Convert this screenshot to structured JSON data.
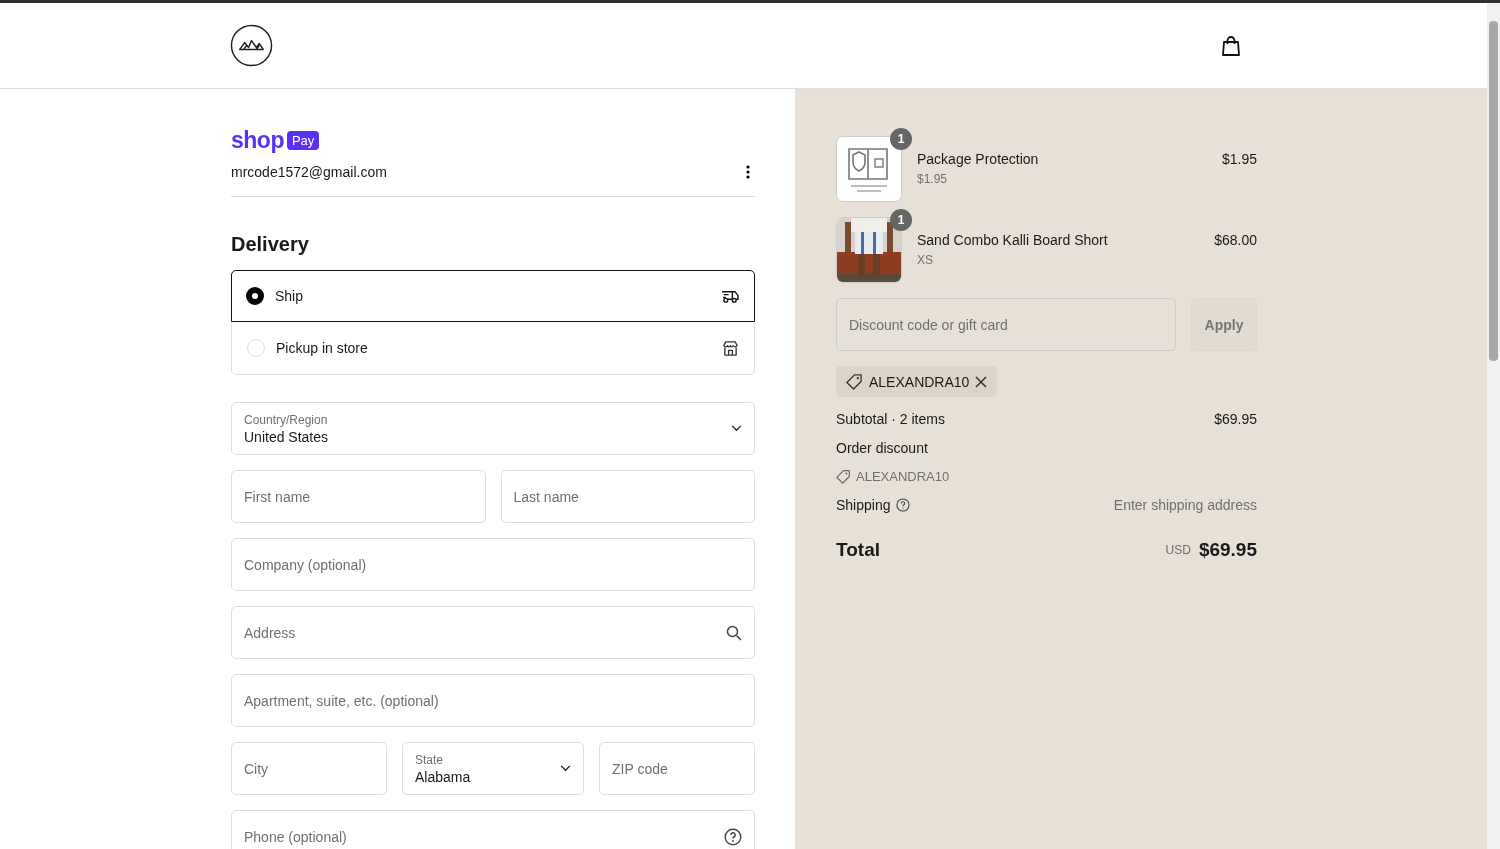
{
  "express": {
    "brand": "shop",
    "badge": "Pay",
    "email": "mrcode1572@gmail.com"
  },
  "delivery": {
    "title": "Delivery",
    "options": [
      {
        "label": "Ship",
        "selected": true
      },
      {
        "label": "Pickup in store",
        "selected": false
      }
    ]
  },
  "address_form": [
    [
      {
        "kind": "select",
        "label": "Country/Region",
        "value": "United States"
      }
    ],
    [
      {
        "kind": "text",
        "placeholder": "First name"
      },
      {
        "kind": "text",
        "placeholder": "Last name"
      }
    ],
    [
      {
        "kind": "text",
        "placeholder": "Company (optional)"
      }
    ],
    [
      {
        "kind": "address",
        "placeholder": "Address"
      }
    ],
    [
      {
        "kind": "text",
        "placeholder": "Apartment, suite, etc. (optional)"
      }
    ],
    [
      {
        "kind": "text",
        "placeholder": "City"
      },
      {
        "kind": "select",
        "label": "State",
        "value": "Alabama"
      },
      {
        "kind": "text",
        "placeholder": "ZIP code"
      }
    ],
    [
      {
        "kind": "phone",
        "placeholder": "Phone (optional)"
      }
    ]
  ],
  "cart": {
    "items": [
      {
        "name": "Package Protection",
        "detail": "$1.95",
        "price": "$1.95",
        "quantity": "1",
        "kind": "illustration"
      },
      {
        "name": "Sand Combo Kalli Board Short",
        "detail": "XS",
        "price": "$68.00",
        "quantity": "1",
        "kind": "picture"
      }
    ],
    "discount": {
      "placeholder": "Discount code or gift card",
      "button": "Apply",
      "applied": "ALEXANDRA10"
    },
    "subtotal": {
      "label": "Subtotal · 2 items",
      "value": "$69.95"
    },
    "order_discount": {
      "label": "Order discount",
      "code": "ALEXANDRA10"
    },
    "shipping": {
      "label": "Shipping",
      "value": "Enter shipping address"
    },
    "total": {
      "label": "Total",
      "currency": "USD",
      "value": "$69.95"
    }
  }
}
